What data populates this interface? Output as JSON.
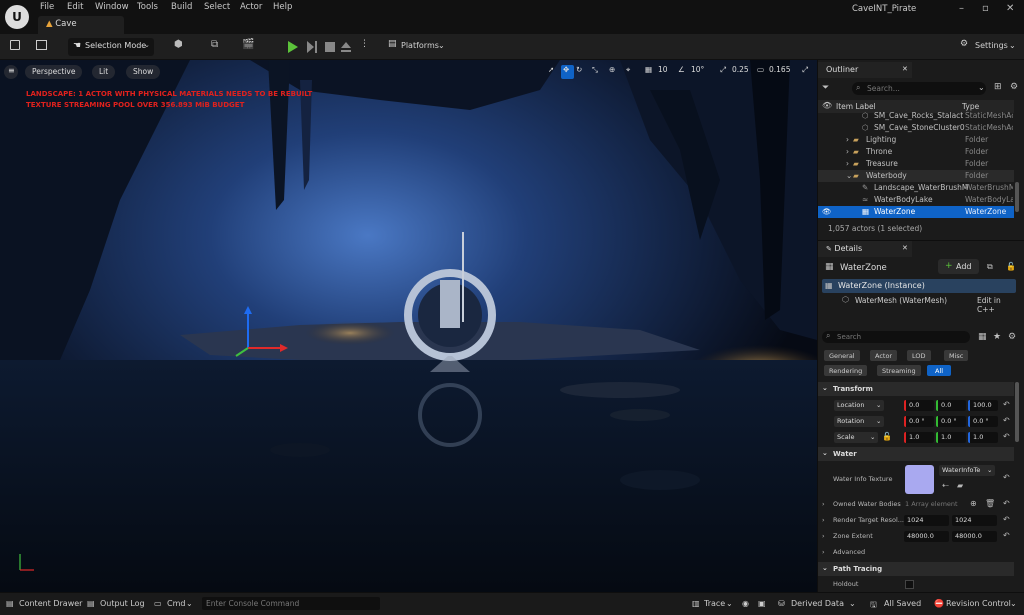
{
  "menu": [
    "File",
    "Edit",
    "Window",
    "Tools",
    "Build",
    "Select",
    "Actor",
    "Help"
  ],
  "doc_tab": "Cave",
  "project_name": "CaveINT_Pirate",
  "toolbar": {
    "selection_mode": "Selection Mode",
    "platforms": "Platforms",
    "settings": "Settings"
  },
  "viewport": {
    "perspective": "Perspective",
    "lit": "Lit",
    "show": "Show",
    "grid_snap": "10",
    "rot_snap": "10°",
    "scale_snap": "0.25",
    "cam_speed": "0.165",
    "warning_1": "LANDSCAPE: 1 ACTOR WITH PHYSICAL MATERIALS NEEDS TO BE REBUILT",
    "warning_2": "TEXTURE STREAMING POOL OVER 356.893 MiB BUDGET"
  },
  "outliner": {
    "tab": "Outliner",
    "search_placeholder": "Search...",
    "col_label": "Item Label",
    "col_type": "Type",
    "rows": [
      {
        "label": "SM_Cave_Rocks_Stalact",
        "type": "StaticMeshActor"
      },
      {
        "label": "SM_Cave_StoneCluster0",
        "type": "StaticMeshActor"
      },
      {
        "label": "Lighting",
        "type": "Folder"
      },
      {
        "label": "Throne",
        "type": "Folder"
      },
      {
        "label": "Treasure",
        "type": "Folder"
      },
      {
        "label": "Waterbody",
        "type": "Folder"
      },
      {
        "label": "Landscape_WaterBrushM",
        "type": "WaterBrushManager"
      },
      {
        "label": "WaterBodyLake",
        "type": "WaterBodyLake"
      },
      {
        "label": "WaterZone",
        "type": "WaterZone"
      }
    ],
    "footer": "1,057 actors (1 selected)"
  },
  "details": {
    "tab": "Details",
    "actor_name": "WaterZone",
    "add": "Add",
    "instance": "WaterZone (Instance)",
    "component": "WaterMesh (WaterMesh)",
    "edit_cpp": "Edit in C++",
    "search_placeholder": "Search",
    "filters": [
      "General",
      "Actor",
      "LOD",
      "Misc",
      "Rendering",
      "Streaming",
      "All"
    ],
    "transform_header": "Transform",
    "location": "Location",
    "rotation": "Rotation",
    "scale": "Scale",
    "loc": [
      "0.0",
      "0.0",
      "100.0"
    ],
    "rot": [
      "0.0 °",
      "0.0 °",
      "0.0 °"
    ],
    "scl": [
      "1.0",
      "1.0",
      "1.0"
    ],
    "water_header": "Water",
    "water_info": "Water Info Texture",
    "water_info_val": "WaterInfoTe",
    "owned": "Owned Water Bodies",
    "owned_val": "1 Array element",
    "rt_res": "Render Target Resol...",
    "rt_x": "1024",
    "rt_y": "1024",
    "zone_ext": "Zone Extent",
    "ze_x": "48000.0",
    "ze_y": "48000.0",
    "advanced": "Advanced",
    "path_tracing": "Path Tracing",
    "holdout": "Holdout"
  },
  "statusbar": {
    "content_drawer": "Content Drawer",
    "output_log": "Output Log",
    "cmd": "Cmd",
    "console_placeholder": "Enter Console Command",
    "trace": "Trace",
    "derived_data": "Derived Data",
    "all_saved": "All Saved",
    "revision": "Revision Control"
  },
  "colors": {
    "accent": "#0070e0",
    "warning": "#e0211d",
    "selected_row": "#0f63c7",
    "play": "#5bc23a"
  }
}
